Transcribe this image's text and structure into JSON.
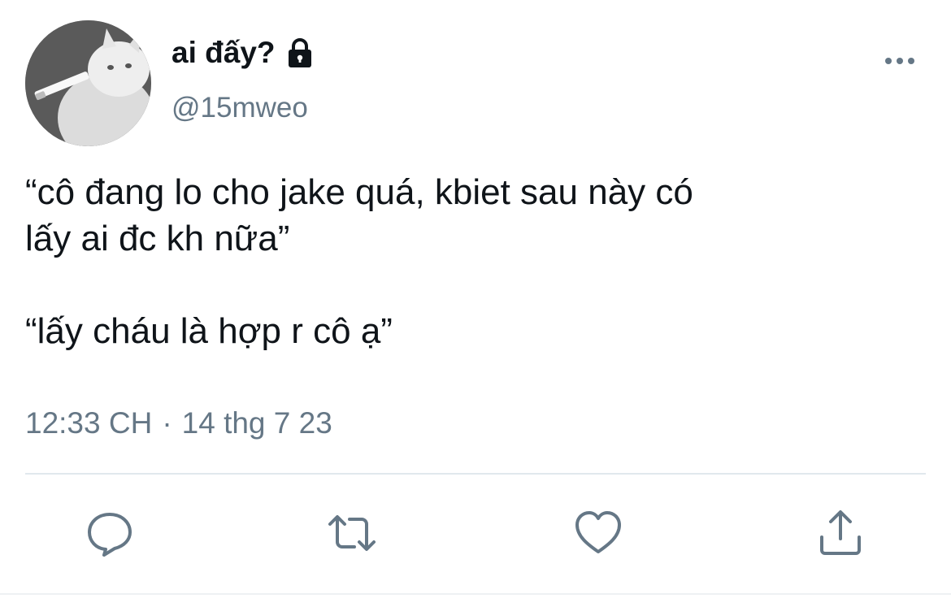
{
  "author": {
    "display_name": "ai đấy?",
    "handle": "@15mweo",
    "avatar_icon": "cat-avatar",
    "protected_icon": "lock-icon"
  },
  "tweet": {
    "text": "“cô đang lo cho jake quá, kbiet sau này có\nlấy ai đc kh nữa”\n\n“lấy cháu là hợp r cô ạ”",
    "time": "12:33 CH",
    "separator": "·",
    "date": "14 thg 7 23"
  },
  "actions": [
    {
      "name": "reply",
      "icon": "reply-icon"
    },
    {
      "name": "retweet",
      "icon": "retweet-icon"
    },
    {
      "name": "like",
      "icon": "heart-icon"
    },
    {
      "name": "share",
      "icon": "share-icon"
    }
  ],
  "colors": {
    "text": "#0f1419",
    "secondary": "#657786",
    "divider": "#e1e8ed"
  }
}
